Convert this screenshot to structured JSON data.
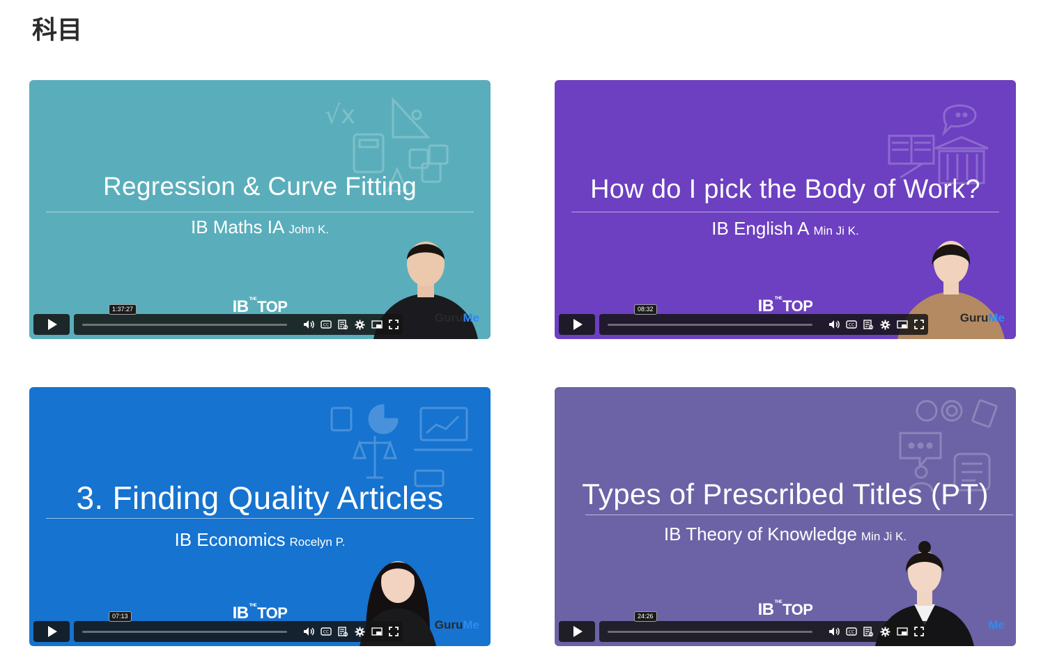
{
  "page": {
    "title": "科目"
  },
  "brand_logo": {
    "prefix": "IB",
    "small": "THE",
    "suffix": "TOP"
  },
  "watermark": {
    "part1": "Guru",
    "part2": "Me"
  },
  "videos": [
    {
      "title": "Regression & Curve Fitting",
      "course": "IB Maths IA",
      "instructor": "John K.",
      "duration": "1:37:27",
      "background_color": "#5aaebb",
      "icon_theme": "math-icons"
    },
    {
      "title": "How do I pick the Body of Work?",
      "course": "IB English A",
      "instructor": "Min Ji K.",
      "duration": "08:32",
      "background_color": "#6c40c0",
      "icon_theme": "literature-icons"
    },
    {
      "title": "3. Finding Quality Articles",
      "course": "IB Economics",
      "instructor": "Rocelyn P.",
      "duration": "07:13",
      "background_color": "#1673d0",
      "icon_theme": "economics-icons"
    },
    {
      "title": "Types of Prescribed Titles (PT)",
      "course": "IB Theory of Knowledge",
      "instructor": "Min Ji K.",
      "duration": "24:26",
      "background_color": "#6b63a6",
      "icon_theme": "knowledge-icons"
    }
  ]
}
